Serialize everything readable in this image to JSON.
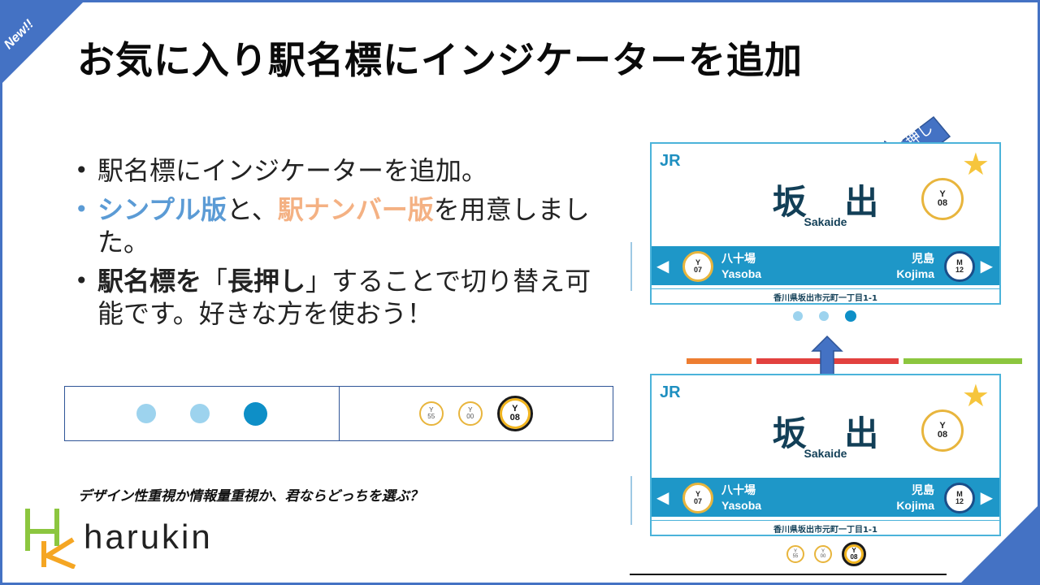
{
  "badge": "New!!",
  "title": "お気に入り駅名標にインジケーターを追加",
  "bullets": {
    "b1": "駅名標にインジケーターを追加。",
    "b2_simple": "シンプル版",
    "b2_mid": "と、",
    "b2_number": "駅ナンバー版",
    "b2_end": "を用意しました。",
    "b3_bold1": "駅名標を",
    "b3_quote_open": "「",
    "b3_bold2": "長押し",
    "b3_quote_close": "」",
    "b3_rest": "することで切り替え可能です。好きな方を使おう！"
  },
  "compare": {
    "number_tags": [
      {
        "line": "Y",
        "num": "55"
      },
      {
        "line": "Y",
        "num": "00"
      },
      {
        "line": "Y",
        "num": "08"
      }
    ]
  },
  "caption": "デザイン性重視か情報量重視か、君ならどっちを選ぶ？",
  "logo": {
    "text": "harukin"
  },
  "longpress_label": "長押し",
  "board": {
    "company": "JR",
    "name_kanji": "坂 出",
    "name_roman": "Sakaide",
    "line": "Y",
    "number": "08",
    "prev": {
      "kanji": "八十場",
      "roman": "Yasoba",
      "line": "Y",
      "number": "07"
    },
    "next": {
      "kanji": "児島",
      "roman": "Kojima",
      "line": "M",
      "number": "12"
    },
    "address": "香川県坂出市元町一丁目1-1"
  },
  "bottom_tags": [
    {
      "line": "Y",
      "num": "55"
    },
    {
      "line": "Y",
      "num": "00"
    },
    {
      "line": "Y",
      "num": "08"
    }
  ],
  "colors": {
    "accent": "#4472c4",
    "simple": "#5b9bd5",
    "number": "#f4b183",
    "board_bar": "#1e97c8",
    "stripe_orange": "#ed7d31",
    "stripe_red": "#e2413f",
    "stripe_green": "#8cc63f"
  }
}
